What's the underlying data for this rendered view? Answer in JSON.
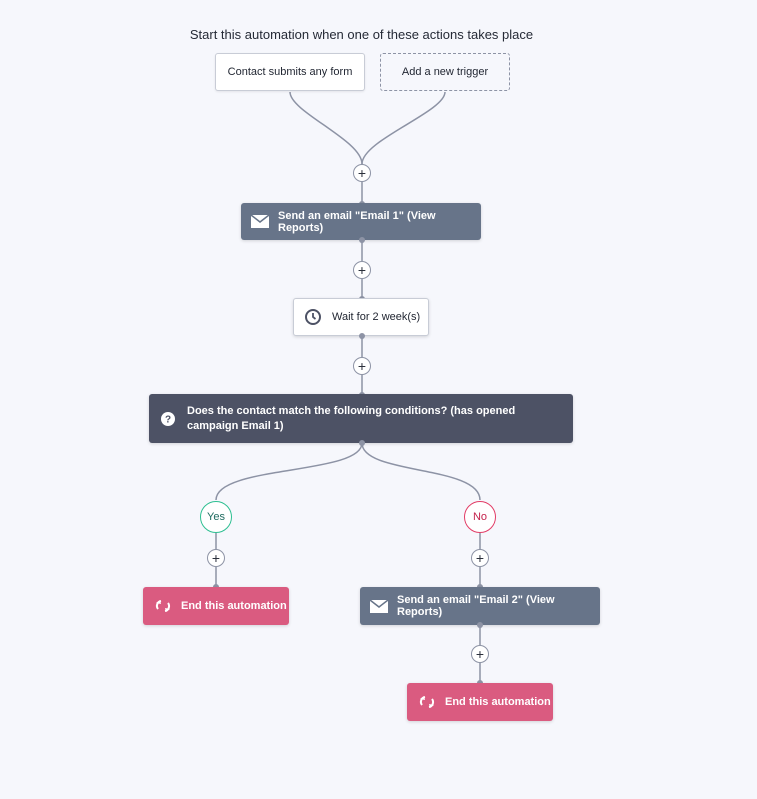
{
  "header": {
    "title": "Start this automation when one of these actions takes place"
  },
  "triggers": [
    {
      "label": "Contact submits any form"
    },
    {
      "label": "Add a new trigger"
    }
  ],
  "add_step_label": "+",
  "steps": {
    "email1": {
      "icon": "envelope-icon",
      "label": "Send an email \"Email 1\" (View Reports)"
    },
    "wait": {
      "icon": "clock-icon",
      "label": "Wait for 2 week(s)"
    },
    "condition": {
      "icon": "question-icon",
      "label": "Does the contact match the following conditions? (has opened campaign Email 1)"
    },
    "yes_branch": {
      "label": "Yes",
      "end": {
        "icon": "refresh-icon",
        "label": "End this automation"
      }
    },
    "no_branch": {
      "label": "No",
      "email2": {
        "icon": "envelope-icon",
        "label": "Send an email \"Email 2\" (View Reports)"
      },
      "end": {
        "icon": "refresh-icon",
        "label": "End this automation"
      }
    }
  },
  "colors": {
    "background": "#f6f7fc",
    "email_node": "#677489",
    "condition_node": "#4d5265",
    "end_node": "#da5b80",
    "yes": "#2dbf91",
    "no": "#e23c66",
    "connector": "#8d93a5"
  }
}
